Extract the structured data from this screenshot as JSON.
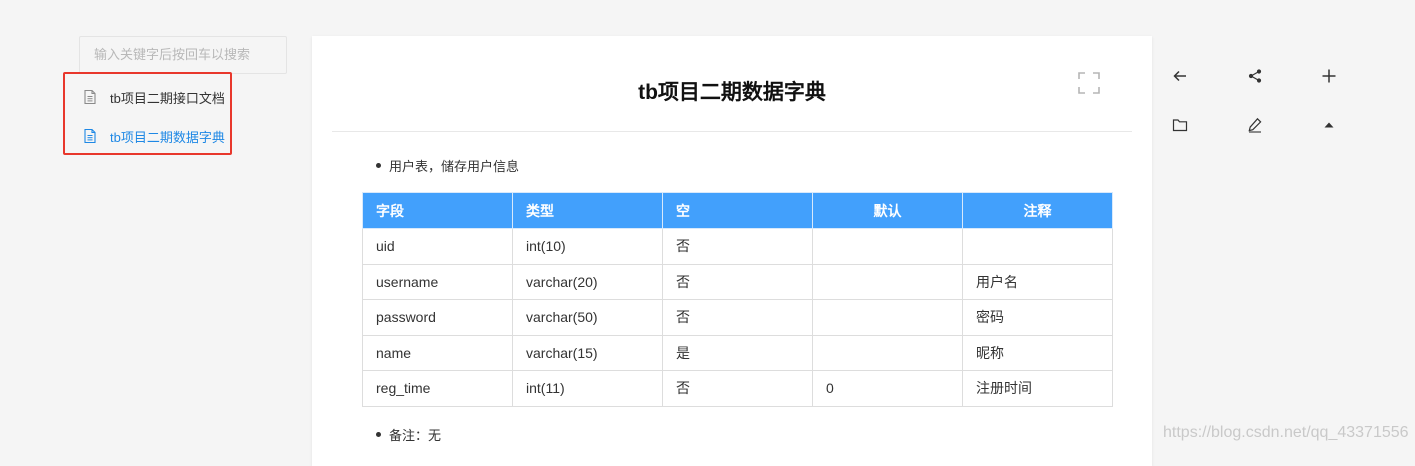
{
  "sidebar": {
    "search_placeholder": "输入关键字后按回车以搜索",
    "items": [
      {
        "label": "tb项目二期接口文档",
        "icon": "document-icon",
        "active": false
      },
      {
        "label": "tb项目二期数据字典",
        "icon": "document-icon",
        "active": true
      }
    ]
  },
  "document": {
    "title": "tb项目二期数据字典",
    "intro": "用户表，储存用户信息",
    "table": {
      "headers": [
        "字段",
        "类型",
        "空",
        "默认",
        "注释"
      ],
      "rows": [
        [
          "uid",
          "int(10)",
          "否",
          "",
          ""
        ],
        [
          "username",
          "varchar(20)",
          "否",
          "",
          "用户名"
        ],
        [
          "password",
          "varchar(50)",
          "否",
          "",
          "密码"
        ],
        [
          "name",
          "varchar(15)",
          "是",
          "",
          "昵称"
        ],
        [
          "reg_time",
          "int(11)",
          "否",
          "0",
          "注册时间"
        ]
      ]
    },
    "note": "备注：无"
  },
  "toolbar": {
    "icons": [
      "back-arrow-icon",
      "share-icon",
      "add-icon",
      "folder-icon",
      "edit-icon",
      "collapse-up-icon"
    ]
  },
  "watermark": "https://blog.csdn.net/qq_43371556",
  "colors": {
    "accent": "#42a0fc",
    "active_link": "#1e88e5",
    "highlight_border": "#e8372c"
  }
}
